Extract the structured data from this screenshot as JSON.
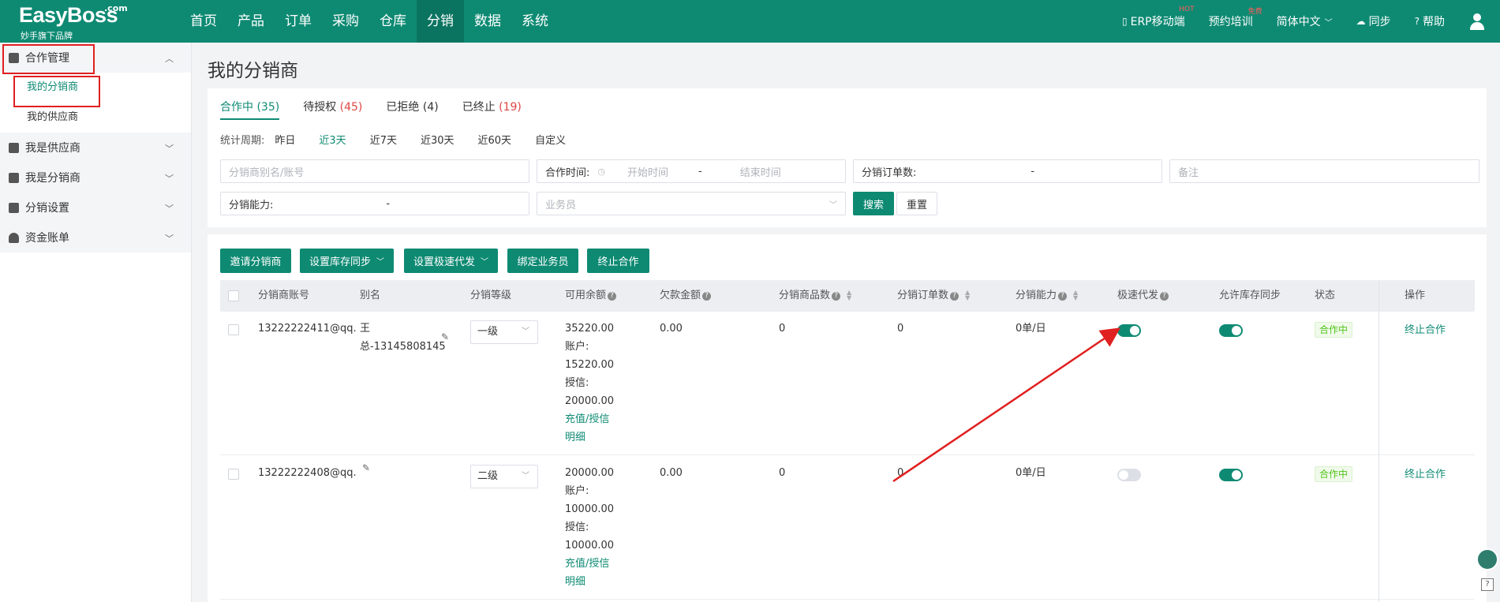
{
  "header": {
    "logo_brand": "EasyBoss",
    "logo_dotcom": ".com",
    "logo_slogan": "妙手旗下品牌",
    "nav": [
      "首页",
      "产品",
      "订单",
      "采购",
      "仓库",
      "分销",
      "数据",
      "系统"
    ],
    "active_nav": "分销",
    "right": {
      "erp_mobile": "ERP移动端",
      "erp_badge": "HOT",
      "training": "预约培训",
      "training_badge": "免费",
      "language": "简体中文",
      "sync": "同步",
      "help": "帮助"
    }
  },
  "sidebar": {
    "groups": [
      {
        "label": "合作管理",
        "expanded": true,
        "items": [
          {
            "label": "我的分销商",
            "active": true
          },
          {
            "label": "我的供应商",
            "active": false
          }
        ]
      },
      {
        "label": "我是供应商",
        "expanded": false
      },
      {
        "label": "我是分销商",
        "expanded": false
      },
      {
        "label": "分销设置",
        "expanded": false
      },
      {
        "label": "资金账单",
        "expanded": false
      }
    ]
  },
  "page": {
    "title": "我的分销商",
    "tabs": [
      {
        "label": "合作中",
        "count": "(35)",
        "active": true
      },
      {
        "label": "待授权",
        "count": "(45)",
        "active": false
      },
      {
        "label": "已拒绝",
        "count": "(4)",
        "active": false
      },
      {
        "label": "已终止",
        "count": "(19)",
        "active": false
      }
    ],
    "period_label": "统计周期:",
    "periods": [
      "昨日",
      "近3天",
      "近7天",
      "近30天",
      "近60天",
      "自定义"
    ],
    "active_period": "近3天",
    "filters": {
      "name_placeholder": "分销商别名/账号",
      "coop_time_label": "合作时间:",
      "start_placeholder": "开始时间",
      "dash": "-",
      "end_placeholder": "结束时间",
      "order_count_label": "分销订单数:",
      "remark_placeholder": "备注",
      "ability_label": "分销能力:",
      "salesman_placeholder": "业务员",
      "search_btn": "搜索",
      "reset_btn": "重置"
    },
    "actions": {
      "invite": "邀请分销商",
      "stock_sync": "设置库存同步",
      "fast_ship": "设置极速代发",
      "bind_salesman": "绑定业务员",
      "terminate": "终止合作"
    },
    "columns": {
      "account": "分销商账号",
      "alias": "别名",
      "grade": "分销等级",
      "balance": "可用余额",
      "debt": "欠款金额",
      "product_count": "分销商品数",
      "order_count": "分销订单数",
      "ability": "分销能力",
      "fast_ship": "极速代发",
      "stock_sync": "允许库存同步",
      "status": "状态",
      "operation": "操作"
    },
    "rows": [
      {
        "account": "13222222411@qq.",
        "alias_line1": "王",
        "alias_line2": "总-13145808145",
        "grade": "一级",
        "balance": "35220.00",
        "account_label": "账户:",
        "account_amount": "15220.00",
        "credit_label": "授信:",
        "credit_amount": "20000.00",
        "detail_link_1": "充值/授信",
        "detail_link_2": "明细",
        "debt": "0.00",
        "product_count": "0",
        "order_count": "0",
        "ability": "0单/日",
        "fast_ship_on": true,
        "stock_sync_on": true,
        "status": "合作中",
        "operation": "终止合作"
      },
      {
        "account": "13222222408@qq.",
        "alias_line1": "",
        "alias_line2": "",
        "grade": "二级",
        "balance": "20000.00",
        "account_label": "账户:",
        "account_amount": "10000.00",
        "credit_label": "授信:",
        "credit_amount": "10000.00",
        "detail_link_1": "充值/授信",
        "detail_link_2": "明细",
        "debt": "0.00",
        "product_count": "0",
        "order_count": "0",
        "ability": "0单/日",
        "fast_ship_on": false,
        "stock_sync_on": true,
        "status": "合作中",
        "operation": "终止合作"
      }
    ]
  },
  "colors": {
    "primary": "#0e8a73",
    "header_bg": "#0e8a73",
    "annotation_red": "#e02020",
    "count_red": "#e04545"
  }
}
